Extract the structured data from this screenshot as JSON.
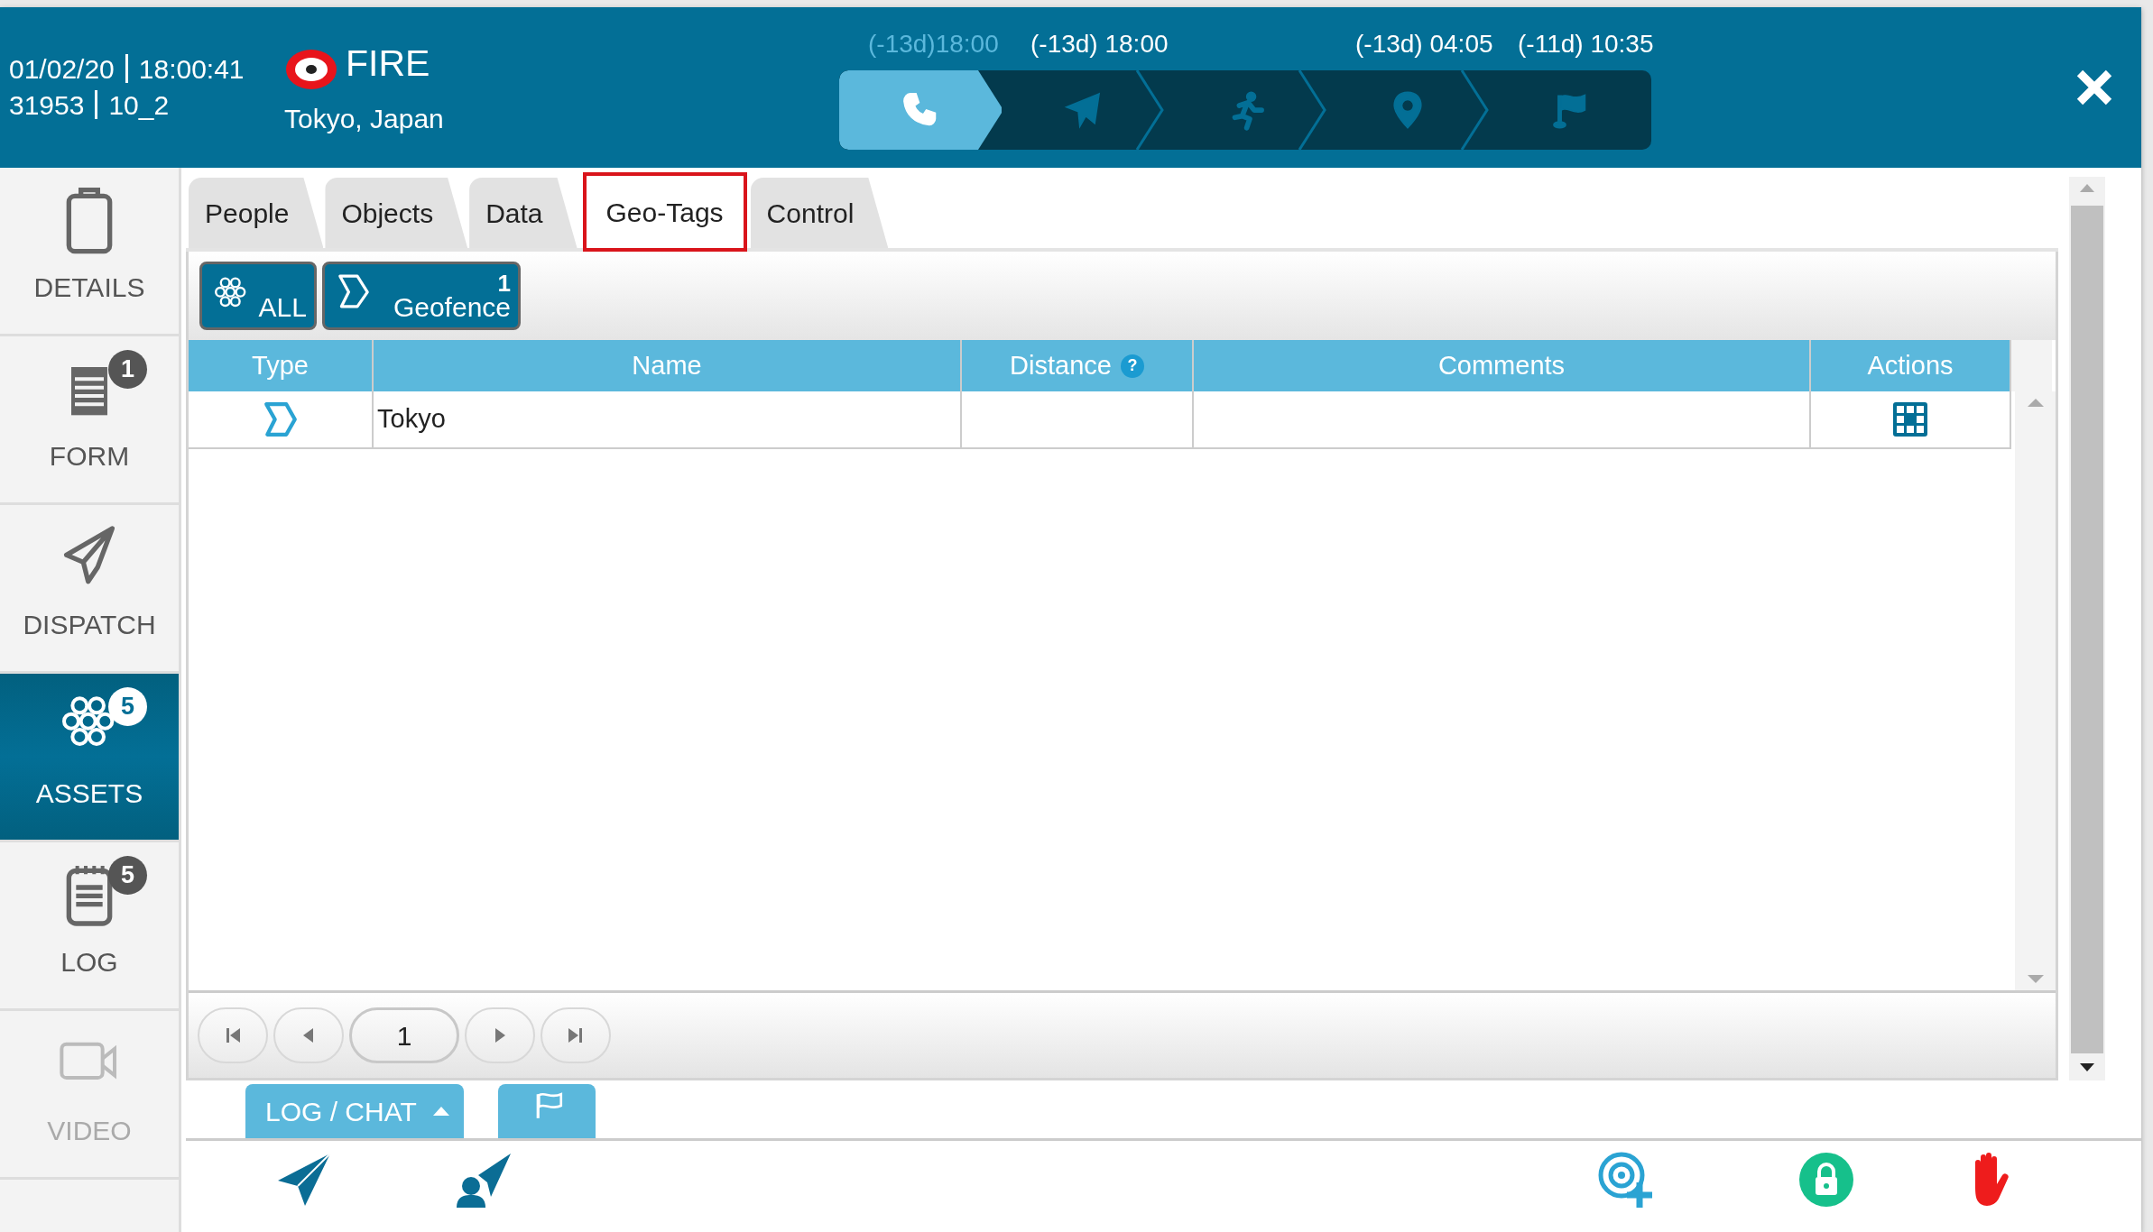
{
  "header": {
    "date": "01/02/20",
    "time": "18:00:41",
    "incident_id": "31953",
    "code": "10_2",
    "type": "FIRE",
    "location": "Tokyo, Japan"
  },
  "timeline": [
    {
      "kind": "call",
      "time": "(-13d)18:00",
      "active": true
    },
    {
      "kind": "dispatch",
      "time": "(-13d) 18:00",
      "active": false
    },
    {
      "kind": "enroute",
      "active": false
    },
    {
      "kind": "onscene",
      "time": "(-13d) 04:05",
      "active": false
    },
    {
      "kind": "closed",
      "time": "(-11d) 10:35",
      "active": false
    }
  ],
  "sidebar": {
    "items": [
      {
        "kind": "details",
        "label": "DETAILS",
        "selected": false,
        "disabled": false
      },
      {
        "kind": "form",
        "label": "FORM",
        "badge": "1",
        "selected": false,
        "disabled": false
      },
      {
        "kind": "dispatch",
        "label": "DISPATCH",
        "selected": false,
        "disabled": false
      },
      {
        "kind": "assets",
        "label": "ASSETS",
        "badge": "5",
        "selected": true,
        "disabled": false
      },
      {
        "kind": "log",
        "label": "LOG",
        "badge": "5",
        "selected": false,
        "disabled": false
      },
      {
        "kind": "video",
        "label": "VIDEO",
        "selected": false,
        "disabled": true
      }
    ]
  },
  "tabs": [
    {
      "label": "People",
      "selected": false
    },
    {
      "label": "Objects",
      "selected": false
    },
    {
      "label": "Data",
      "selected": false
    },
    {
      "label": "Geo-Tags",
      "selected": true
    },
    {
      "label": "Control",
      "selected": false
    }
  ],
  "filters": [
    {
      "kind": "all",
      "label": "ALL"
    },
    {
      "kind": "geofence",
      "label": "Geofence",
      "count": "1"
    }
  ],
  "table": {
    "columns": [
      {
        "label": "Type"
      },
      {
        "label": "Name"
      },
      {
        "label": "Distance",
        "help": "?"
      },
      {
        "label": "Comments"
      },
      {
        "label": "Actions"
      }
    ],
    "rows": [
      {
        "kind": "geofence",
        "name": "Tokyo"
      }
    ]
  },
  "pager": {
    "page": "1"
  },
  "bottom_tabs": [
    {
      "kind": "text",
      "label": "LOG / CHAT"
    },
    {
      "kind": "flag"
    }
  ]
}
